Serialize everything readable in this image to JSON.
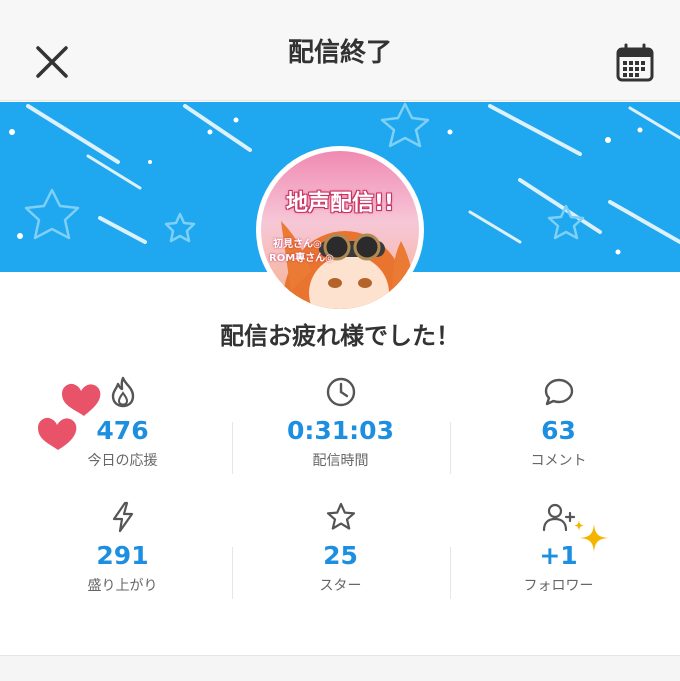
{
  "header": {
    "title": "配信終了",
    "close_icon": "close-icon",
    "calendar_icon": "calendar-icon"
  },
  "banner": {
    "color": "#1fa7ef",
    "avatar_text": "地声配信!!",
    "avatar_sub": "初見さん◎",
    "avatar_sub2": "ROM専さん◎"
  },
  "message": "配信お疲れ様でした！",
  "stats": [
    {
      "icon": "flame-icon",
      "value": "476",
      "label": "今日の応援"
    },
    {
      "icon": "clock-icon",
      "value": "0:31:03",
      "label": "配信時間"
    },
    {
      "icon": "comment-icon",
      "value": "63",
      "label": "コメント"
    },
    {
      "icon": "lightning-icon",
      "value": "291",
      "label": "盛り上がり"
    },
    {
      "icon": "star-icon",
      "value": "25",
      "label": "スター"
    },
    {
      "icon": "user-plus-icon",
      "value": "+1",
      "label": "フォロワー"
    }
  ],
  "colors": {
    "accent": "#1d8fe1",
    "heart": "#e8536a",
    "sparkle": "#f5b400"
  }
}
